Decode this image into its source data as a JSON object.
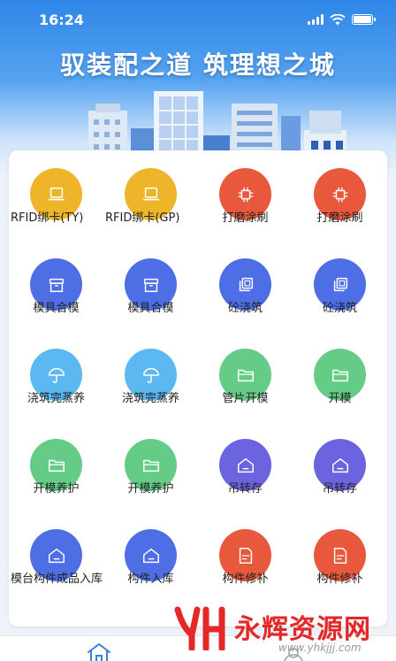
{
  "status_bar": {
    "time": "16:24"
  },
  "banner": {
    "slogan": "驭装配之道 筑理想之城"
  },
  "colors": {
    "yellow": "#eeb52b",
    "red": "#e8583d",
    "blue": "#4e6ee5",
    "sky": "#5bb8f0",
    "green": "#64cc86",
    "purple": "#6c63e0"
  },
  "menu": [
    {
      "label": "RFID绑卡(TY)",
      "color": "yellow",
      "icon": "laptop-icon"
    },
    {
      "label": "RFID绑卡(GP)",
      "color": "yellow",
      "icon": "laptop-icon"
    },
    {
      "label": "打磨涂刷",
      "color": "red",
      "icon": "chip-icon"
    },
    {
      "label": "打磨涂刷",
      "color": "red",
      "icon": "chip-icon"
    },
    {
      "label": "模具合模",
      "color": "blue",
      "icon": "box-icon"
    },
    {
      "label": "模具合模",
      "color": "blue",
      "icon": "box-icon"
    },
    {
      "label": "砼浇筑",
      "color": "blue",
      "icon": "layers-icon"
    },
    {
      "label": "砼浇筑",
      "color": "blue",
      "icon": "layers-icon"
    },
    {
      "label": "浇筑完蒸养",
      "color": "sky",
      "icon": "umbrella-icon"
    },
    {
      "label": "浇筑完蒸养",
      "color": "sky",
      "icon": "umbrella-icon"
    },
    {
      "label": "管片开模",
      "color": "green",
      "icon": "folder-icon"
    },
    {
      "label": "开模",
      "color": "green",
      "icon": "folder-icon"
    },
    {
      "label": "开模养护",
      "color": "green",
      "icon": "folder-icon"
    },
    {
      "label": "开模养护",
      "color": "green",
      "icon": "folder-icon"
    },
    {
      "label": "吊转存",
      "color": "purple",
      "icon": "house-icon"
    },
    {
      "label": "吊转存",
      "color": "purple",
      "icon": "house-icon"
    },
    {
      "label": "模台构件成品入库",
      "color": "blue",
      "icon": "house-icon"
    },
    {
      "label": "构件入库",
      "color": "blue",
      "icon": "house-icon"
    },
    {
      "label": "构件修补",
      "color": "red",
      "icon": "note-icon"
    },
    {
      "label": "构件修补",
      "color": "red",
      "icon": "note-icon"
    }
  ],
  "watermark": {
    "title": "永辉资源网",
    "url": "www.yhkjjj.com"
  }
}
